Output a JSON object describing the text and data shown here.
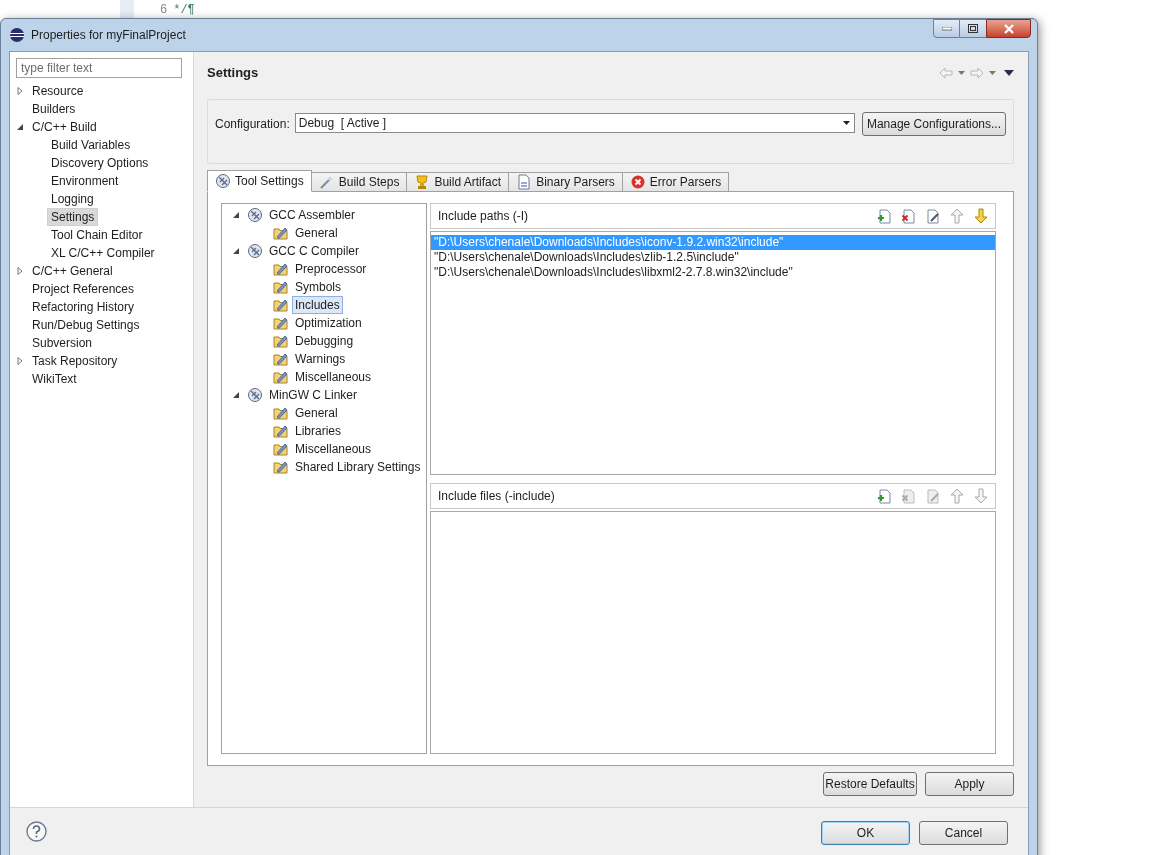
{
  "background_editor": {
    "line_number": "6",
    "code": "*/¶"
  },
  "window": {
    "title": "Properties for myFinalProject"
  },
  "filter": {
    "placeholder": "type filter text"
  },
  "sidebar": {
    "items": [
      {
        "label": "Resource",
        "expanded": false,
        "selected": false
      },
      {
        "label": "Builders",
        "selected": false
      },
      {
        "label": "C/C++ Build",
        "expanded": true,
        "selected": false,
        "children": [
          {
            "label": "Build Variables",
            "selected": false
          },
          {
            "label": "Discovery Options",
            "selected": false
          },
          {
            "label": "Environment",
            "selected": false
          },
          {
            "label": "Logging",
            "selected": false
          },
          {
            "label": "Settings",
            "selected": true
          },
          {
            "label": "Tool Chain Editor",
            "selected": false
          },
          {
            "label": "XL C/C++ Compiler",
            "selected": false
          }
        ]
      },
      {
        "label": "C/C++ General",
        "expanded": false,
        "selected": false
      },
      {
        "label": "Project References",
        "selected": false
      },
      {
        "label": "Refactoring History",
        "selected": false
      },
      {
        "label": "Run/Debug Settings",
        "selected": false
      },
      {
        "label": "Subversion",
        "selected": false
      },
      {
        "label": "Task Repository",
        "expanded": false,
        "selected": false
      },
      {
        "label": "WikiText",
        "selected": false
      }
    ]
  },
  "page": {
    "title": "Settings"
  },
  "configuration": {
    "label": "Configuration:",
    "value": "Debug  [ Active ]",
    "manage_button": "Manage Configurations..."
  },
  "tabs": [
    {
      "label": "Tool Settings",
      "kind": "tool",
      "selected": true
    },
    {
      "label": "Build Steps",
      "kind": "steps",
      "selected": false
    },
    {
      "label": "Build Artifact",
      "kind": "artifact",
      "selected": false
    },
    {
      "label": "Binary Parsers",
      "kind": "binary",
      "selected": false
    },
    {
      "label": "Error Parsers",
      "kind": "error",
      "selected": false
    }
  ],
  "tool_tree": [
    {
      "label": "GCC Assembler",
      "expanded": true,
      "selected": false,
      "children": [
        {
          "label": "General",
          "selected": false
        }
      ]
    },
    {
      "label": "GCC C Compiler",
      "expanded": true,
      "selected": false,
      "children": [
        {
          "label": "Preprocessor",
          "selected": false
        },
        {
          "label": "Symbols",
          "selected": false
        },
        {
          "label": "Includes",
          "selected": true
        },
        {
          "label": "Optimization",
          "selected": false
        },
        {
          "label": "Debugging",
          "selected": false
        },
        {
          "label": "Warnings",
          "selected": false
        },
        {
          "label": "Miscellaneous",
          "selected": false
        }
      ]
    },
    {
      "label": "MinGW C Linker",
      "expanded": true,
      "selected": false,
      "children": [
        {
          "label": "General",
          "selected": false
        },
        {
          "label": "Libraries",
          "selected": false
        },
        {
          "label": "Miscellaneous",
          "selected": false
        },
        {
          "label": "Shared Library Settings",
          "selected": false
        }
      ]
    }
  ],
  "lists": [
    {
      "title": "Include paths (-I)",
      "tools": [
        {
          "kind": "add",
          "disabled": false
        },
        {
          "kind": "delete",
          "disabled": false
        },
        {
          "kind": "edit",
          "disabled": false
        },
        {
          "kind": "up",
          "disabled": true
        },
        {
          "kind": "down",
          "disabled": false
        }
      ],
      "rows": [
        {
          "text": "\"D:\\Users\\chenale\\Downloads\\Includes\\iconv-1.9.2.win32\\include\"",
          "selected": true
        },
        {
          "text": "\"D:\\Users\\chenale\\Downloads\\Includes\\zlib-1.2.5\\include\"",
          "selected": false
        },
        {
          "text": "\"D:\\Users\\chenale\\Downloads\\Includes\\libxml2-2.7.8.win32\\include\"",
          "selected": false
        }
      ]
    },
    {
      "title": "Include files (-include)",
      "tools": [
        {
          "kind": "add",
          "disabled": false
        },
        {
          "kind": "delete",
          "disabled": true
        },
        {
          "kind": "edit",
          "disabled": true
        },
        {
          "kind": "up",
          "disabled": true
        },
        {
          "kind": "down",
          "disabled": true
        }
      ]
    }
  ],
  "page_buttons": [
    "Restore Defaults",
    "Apply"
  ],
  "dialog_buttons": [
    {
      "label": "OK",
      "default": true
    },
    {
      "label": "Cancel",
      "default": false
    }
  ]
}
